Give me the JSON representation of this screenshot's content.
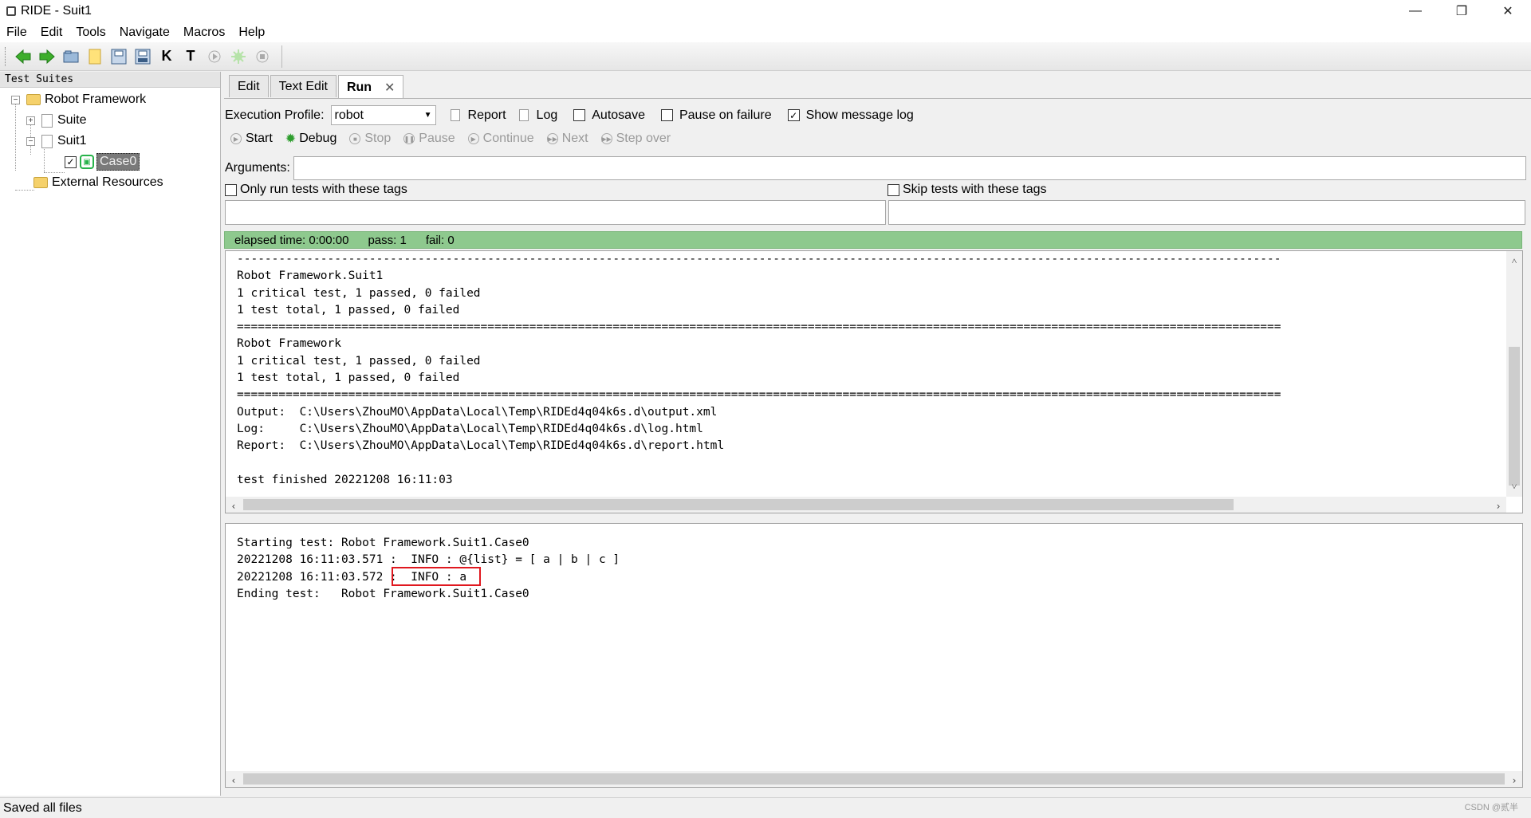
{
  "window": {
    "title": "RIDE - Suit1",
    "minimize": "—",
    "restore": "❐",
    "close": "✕"
  },
  "menu": [
    {
      "label": "File"
    },
    {
      "label": "Edit"
    },
    {
      "label": "Tools"
    },
    {
      "label": "Navigate"
    },
    {
      "label": "Macros"
    },
    {
      "label": "Help"
    }
  ],
  "toolbar": {
    "icons": [
      "back-icon",
      "forward-icon",
      "open-dir-icon",
      "open-file-icon",
      "save-icon",
      "save-all-icon",
      "search-keywords-icon",
      "search-tests-icon",
      "run-icon",
      "debug-icon",
      "stop-icon"
    ],
    "k_label": "K",
    "t_label": "T"
  },
  "tree": {
    "header": "Test Suites",
    "root": "Robot Framework",
    "suite": "Suite",
    "suit1": "Suit1",
    "case0": "Case0",
    "external": "External Resources"
  },
  "tabs": [
    {
      "label": "Edit",
      "active": false
    },
    {
      "label": "Text Edit",
      "active": false
    },
    {
      "label": "Run",
      "active": true
    }
  ],
  "run": {
    "profile_label": "Execution Profile:",
    "profile_value": "robot",
    "report": "Report",
    "log": "Log",
    "autosave": {
      "label": "Autosave",
      "checked": false
    },
    "pause_on_failure": {
      "label": "Pause on failure",
      "checked": false
    },
    "show_message_log": {
      "label": "Show message log",
      "checked": true
    },
    "controls": [
      {
        "label": "Start",
        "enabled": true
      },
      {
        "label": "Debug",
        "enabled": true
      },
      {
        "label": "Stop",
        "enabled": false
      },
      {
        "label": "Pause",
        "enabled": false
      },
      {
        "label": "Continue",
        "enabled": false
      },
      {
        "label": "Next",
        "enabled": false
      },
      {
        "label": "Step over",
        "enabled": false
      }
    ],
    "arguments_label": "Arguments:",
    "arguments_value": "",
    "only_run_tags": {
      "label": "Only run tests with these tags",
      "checked": false
    },
    "skip_tags": {
      "label": "Skip tests with these tags",
      "checked": false
    },
    "status": {
      "elapsed": "elapsed time: 0:00:00",
      "pass": "pass: 1",
      "fail": "fail: 0",
      "color": "#8ec98e"
    }
  },
  "output_lines": [
    "------------------------------------------------------------------------------------------------------------------------------------------------------",
    "Robot Framework.Suit1",
    "1 critical test, 1 passed, 0 failed",
    "1 test total, 1 passed, 0 failed",
    "======================================================================================================================================================",
    "Robot Framework",
    "1 critical test, 1 passed, 0 failed",
    "1 test total, 1 passed, 0 failed",
    "======================================================================================================================================================",
    "Output:  C:\\Users\\ZhouMO\\AppData\\Local\\Temp\\RIDEd4q04k6s.d\\output.xml",
    "Log:     C:\\Users\\ZhouMO\\AppData\\Local\\Temp\\RIDEd4q04k6s.d\\log.html",
    "Report:  C:\\Users\\ZhouMO\\AppData\\Local\\Temp\\RIDEd4q04k6s.d\\report.html",
    "",
    "test finished 20221208 16:11:03"
  ],
  "message_lines": [
    "Starting test: Robot Framework.Suit1.Case0",
    "20221208 16:11:03.571 :  INFO : @{list} = [ a | b | c ]",
    "20221208 16:11:03.572 :  INFO : a",
    "Ending test:   Robot Framework.Suit1.Case0"
  ],
  "statusbar": {
    "text": "Saved all files"
  },
  "watermark": "CSDN @贰半"
}
